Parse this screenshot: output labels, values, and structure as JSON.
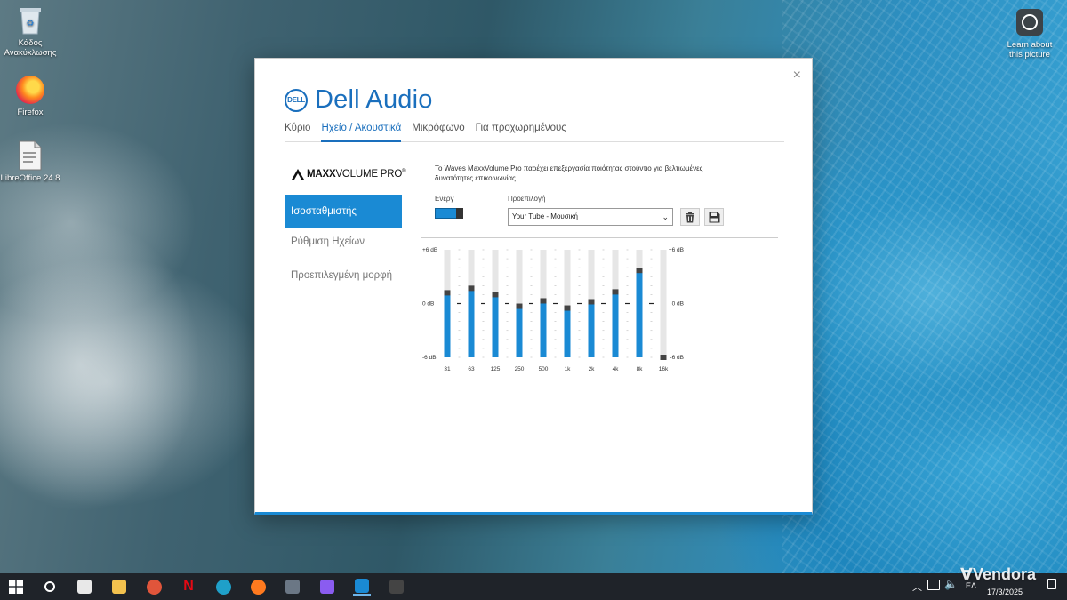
{
  "desktop": {
    "icons": [
      {
        "label": "Κάδος Ανακύκλωσης"
      },
      {
        "label": "Firefox"
      },
      {
        "label": "LibreOffice 24.8"
      }
    ],
    "spotlight_label": "Learn about this picture"
  },
  "window": {
    "title": "Dell Audio",
    "logo_text": "DELL",
    "close_glyph": "×",
    "tabs": [
      {
        "label": "Κύριο"
      },
      {
        "label": "Ηχείο / Ακουστικά"
      },
      {
        "label": "Μικρόφωνο"
      },
      {
        "label": "Για προχωρημένους"
      }
    ],
    "active_tab": "Ηχείο / Ακουστικά",
    "maxx_brand": {
      "bold": "MAXX",
      "rest": "VOLUME PRO",
      "mark": "®"
    },
    "sidebar": [
      {
        "label": "Ισοσταθμιστής",
        "active": true
      },
      {
        "label": "Ρύθμιση Ηχείων",
        "active": false
      },
      {
        "label": "Προεπιλεγμένη μορφή",
        "active": false
      }
    ],
    "description": "Το Waves MaxxVolume Pro παρέχει επεξεργασία ποιότητας στούντιο για βελτιωμένες δυνατότητες επικοινωνίας.",
    "toggle": {
      "label": "Ενεργ",
      "on": true
    },
    "preset": {
      "label": "Προεπιλογή",
      "value": "Your Tube - Μουσική"
    },
    "buttons": {
      "delete": "trash-icon",
      "save": "save-icon"
    },
    "accent_color": "#1a8ad4"
  },
  "equalizer": {
    "scale_labels": {
      "top": "+6 dB",
      "mid": "0 dB",
      "bottom": "-6 dB"
    },
    "range_db": [
      -6,
      6
    ],
    "bands": [
      {
        "freq": "31",
        "db": 1.2
      },
      {
        "freq": "63",
        "db": 1.7
      },
      {
        "freq": "125",
        "db": 1.0
      },
      {
        "freq": "250",
        "db": -0.3
      },
      {
        "freq": "500",
        "db": 0.3
      },
      {
        "freq": "1k",
        "db": -0.5
      },
      {
        "freq": "2k",
        "db": 0.2
      },
      {
        "freq": "4k",
        "db": 1.3
      },
      {
        "freq": "8k",
        "db": 3.7
      },
      {
        "freq": "16k",
        "db": -6.0
      }
    ]
  },
  "taskbar": {
    "apps": [
      {
        "icon": "search-icon"
      },
      {
        "icon": "store-icon"
      },
      {
        "icon": "file-explorer-icon"
      },
      {
        "icon": "media-player-icon"
      },
      {
        "icon": "netflix-icon"
      },
      {
        "icon": "edge-icon"
      },
      {
        "icon": "firefox-icon"
      },
      {
        "icon": "calculator-icon"
      },
      {
        "icon": "copilot-icon"
      },
      {
        "icon": "dell-audio-icon"
      },
      {
        "icon": "speaker-app-icon"
      }
    ],
    "lang": "ΕΛ",
    "date": "17/3/2025"
  },
  "watermark": "Vendora"
}
